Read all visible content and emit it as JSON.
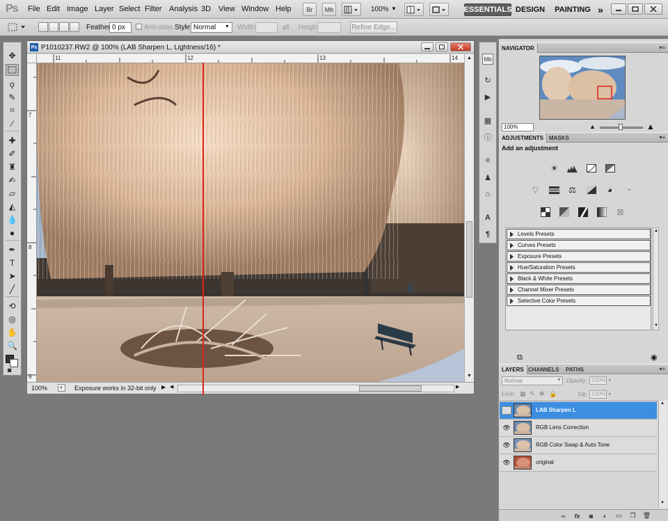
{
  "menubar": {
    "logo": "Ps",
    "items": [
      "File",
      "Edit",
      "Image",
      "Layer",
      "Select",
      "Filter",
      "Analysis",
      "3D",
      "View",
      "Window",
      "Help"
    ],
    "bridge_label": "Br",
    "minibridge_label": "Mb",
    "zoom": "100%",
    "workspaces": [
      "ESSENTIALS",
      "DESIGN",
      "PAINTING"
    ],
    "more": "»"
  },
  "options": {
    "feather_label": "Feather:",
    "feather_value": "0 px",
    "antialias_label": "Anti-alias",
    "style_label": "Style:",
    "style_value": "Normal",
    "width_label": "Width:",
    "height_label": "Height:",
    "refine_edge": "Refine Edge..."
  },
  "document": {
    "title": "P1010237.RW2 @ 100% (LAB Sharpen L, Lightness/16) *",
    "ps_badge": "Ps",
    "ruler_h": [
      "11",
      "12",
      "13",
      "14"
    ],
    "ruler_v": [
      "7",
      "8",
      "9"
    ],
    "zoom": "100%",
    "status": "Exposure works in 32-bit only"
  },
  "navigator": {
    "tab": "NAVIGATOR",
    "zoom": "100%"
  },
  "adjustments": {
    "tabs": [
      "ADJUSTMENTS",
      "MASKS"
    ],
    "heading": "Add an adjustment",
    "presets": [
      "Levels Presets",
      "Curves Presets",
      "Exposure Presets",
      "Hue/Saturation Presets",
      "Black & White Presets",
      "Channel Mixer Presets",
      "Selective Color Presets"
    ]
  },
  "layers": {
    "tabs": [
      "LAYERS",
      "CHANNELS",
      "PATHS"
    ],
    "blend_mode": "Normal",
    "opacity_label": "Opacity:",
    "opacity_value": "100%",
    "lock_label": "Lock:",
    "fill_label": "Fill:",
    "fill_value": "100%",
    "items": [
      {
        "name": "LAB Sharpen L",
        "selected": true
      },
      {
        "name": "RGB Lens Correction",
        "selected": false
      },
      {
        "name": "RGB Color Swap & Auto Tone",
        "selected": false
      },
      {
        "name": "original",
        "selected": false
      }
    ],
    "footer_fx": "fx"
  },
  "colors": {
    "selection_blue": "#3c8ee0",
    "guide_red": "#e0201a",
    "close_red": "#c23a25"
  }
}
